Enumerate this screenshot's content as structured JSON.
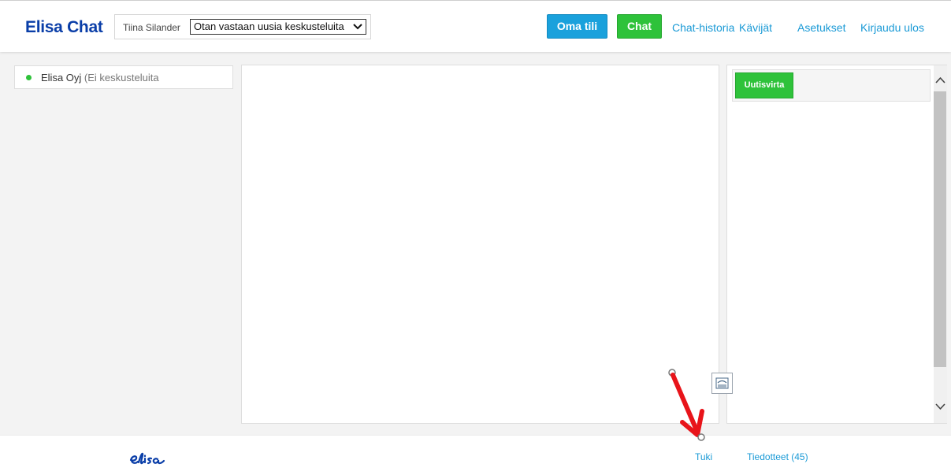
{
  "header": {
    "brand": "Elisa Chat",
    "user_name": "Tiina Silander",
    "status_selected": "Otan vastaan uusia keskusteluita",
    "buttons": {
      "account": "Oma tili",
      "chat": "Chat"
    },
    "nav": {
      "history": "Chat-historia",
      "visitors": "Kävijät",
      "settings": "Asetukset",
      "logout": "Kirjaudu ulos"
    }
  },
  "contacts": [
    {
      "name": "Elisa Oyj",
      "status": "(Ei keskusteluita"
    }
  ],
  "news_panel": {
    "button_label": "Uutisvirta"
  },
  "footer": {
    "logo_text": "elisa",
    "links": {
      "support": "Tuki",
      "notices": "Tiedotteet (45)"
    }
  },
  "colors": {
    "brand": "#0a3ea8",
    "accent_blue": "#1aa1dc",
    "accent_green": "#2ec23a",
    "link": "#1a9ad6",
    "annotation": "#e8141a"
  },
  "icons": {
    "status_caret": "chevron-down-icon",
    "scroll_up": "chevron-up-icon",
    "scroll_down": "chevron-down-icon",
    "floating": "print-preview-icon"
  }
}
